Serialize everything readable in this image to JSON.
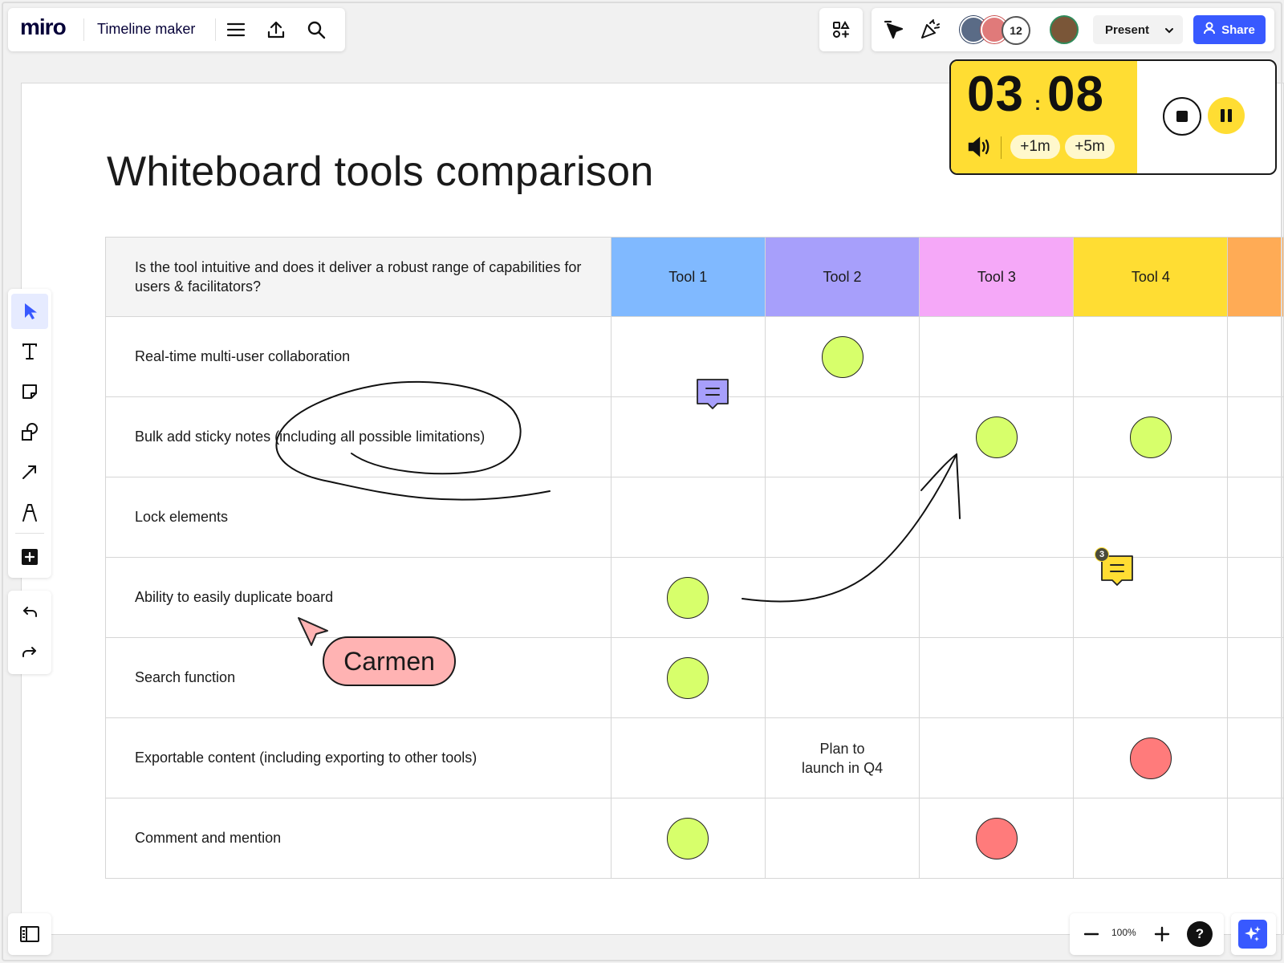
{
  "app": {
    "logo": "miro",
    "board_name": "Timeline maker"
  },
  "toolbar": {
    "present_label": "Present",
    "share_label": "Share",
    "collaborators_count": "12"
  },
  "timer": {
    "minutes": "03",
    "separator": ":",
    "seconds": "08",
    "add_1m": "+1m",
    "add_5m": "+5m"
  },
  "board": {
    "title": "Whiteboard tools comparison",
    "question": "Is the tool intuitive and does it deliver a robust range of capabilities for users & facilitators?",
    "tools": [
      "Tool 1",
      "Tool 2",
      "Tool 3",
      "Tool 4"
    ],
    "tool_colors": [
      "#80b9ff",
      "#a79ffb",
      "#f5a8f8",
      "#ffdd33",
      "#ffab55"
    ],
    "status_colors": {
      "yes": "#d7ff6b",
      "no": "#ff7b7b"
    },
    "rows": [
      {
        "label": "Real-time multi-user collaboration",
        "cells": [
          "",
          "yes",
          "",
          ""
        ]
      },
      {
        "label": "Bulk add sticky notes (including all possible limitations)",
        "cells": [
          "",
          "",
          "yes",
          "yes"
        ]
      },
      {
        "label": "Lock elements",
        "cells": [
          "",
          "",
          "",
          ""
        ]
      },
      {
        "label": "Ability to easily duplicate board",
        "cells": [
          "yes",
          "",
          "",
          ""
        ]
      },
      {
        "label": "Search function",
        "cells": [
          "yes",
          "",
          "",
          ""
        ]
      },
      {
        "label": "Exportable content (including exporting to other tools)",
        "cells": [
          "",
          "Plan to launch in Q4",
          "",
          "no"
        ]
      },
      {
        "label": "Comment and mention",
        "cells": [
          "yes",
          "",
          "no",
          ""
        ]
      }
    ],
    "comment_badge": "3",
    "cursor_user": "Carmen"
  },
  "zoom": {
    "level": "100%"
  },
  "help_label": "?",
  "icons": [
    "hamburger-menu-icon",
    "upload-icon",
    "search-icon",
    "apps-icon",
    "cursor-select-icon",
    "celebrate-icon",
    "chevron-down-icon",
    "user-icon",
    "volume-icon",
    "stop-icon",
    "pause-icon",
    "select-icon",
    "text-icon",
    "sticky-note-icon",
    "shapes-icon",
    "arrow-line-icon",
    "pen-icon",
    "add-icon",
    "undo-icon",
    "redo-icon",
    "panel-toggle-icon",
    "zoom-out-icon",
    "zoom-in-icon",
    "help-icon",
    "sparkle-ai-icon",
    "comment-icon"
  ]
}
